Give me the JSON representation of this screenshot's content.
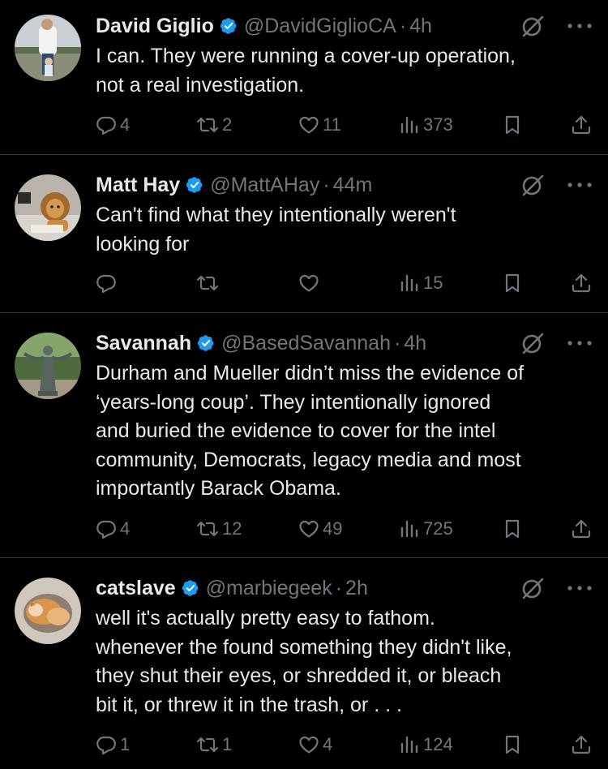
{
  "tweets": [
    {
      "name": "David Giglio",
      "handle": "@DavidGiglioCA",
      "time": "4h",
      "text": "I can. They were running a cover-up operation,\nnot a real investigation.",
      "replies": "4",
      "reposts": "2",
      "likes": "11",
      "views": "373"
    },
    {
      "name": "Matt Hay",
      "handle": "@MattAHay",
      "time": "44m",
      "text": "Can't find what they intentionally weren't\nlooking for",
      "replies": "",
      "reposts": "",
      "likes": "",
      "views": "15"
    },
    {
      "name": "Savannah",
      "handle": "@BasedSavannah",
      "time": "4h",
      "text": "Durham and Mueller didn’t miss the evidence of\n‘years-long coup’. They intentionally ignored\nand buried the evidence to cover for the intel\ncommunity, Democrats, legacy media and most\nimportantly Barack Obama.",
      "replies": "4",
      "reposts": "12",
      "likes": "49",
      "views": "725"
    },
    {
      "name": "catslave",
      "handle": "@marbiegeek",
      "time": "2h",
      "text": "well it's actually pretty easy to fathom.\nwhenever the found something they didn't like,\nthey shut their eyes,  or shredded it,  or bleach\nbit it, or threw it in the trash,  or . . .",
      "replies": "1",
      "reposts": "1",
      "likes": "4",
      "views": "124"
    }
  ],
  "separator": "·",
  "colors": {
    "background": "#000000",
    "text": "#e7e9ea",
    "muted": "#71767b",
    "verified": "#1d9bf0",
    "divider": "#2f3336"
  },
  "icons": [
    "verified-badge-icon",
    "grok-icon",
    "more-icon",
    "reply-icon",
    "repost-icon",
    "like-icon",
    "views-icon",
    "bookmark-icon",
    "share-icon"
  ]
}
